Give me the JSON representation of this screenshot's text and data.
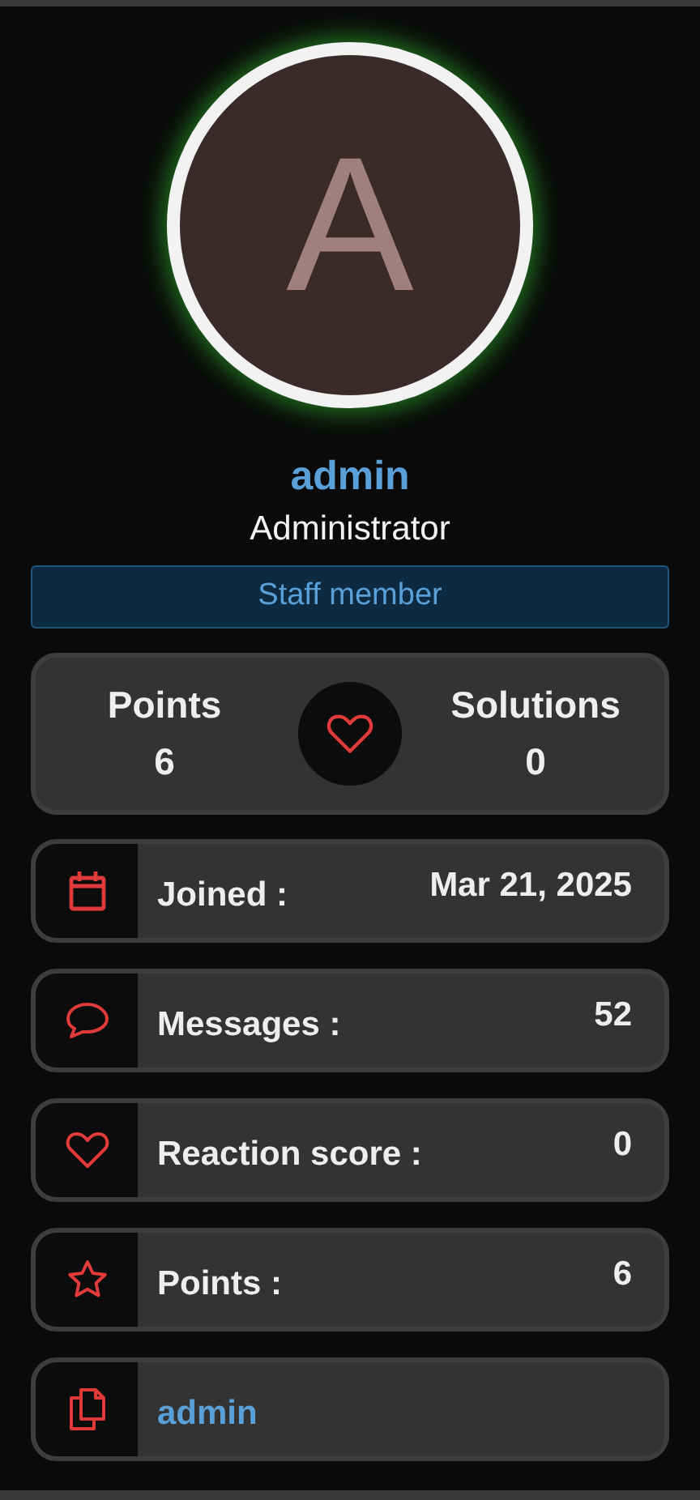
{
  "avatar": {
    "letter": "A"
  },
  "username": "admin",
  "role": "Administrator",
  "badge": "Staff member",
  "stats": [
    {
      "label": "Points",
      "value": "6"
    },
    {
      "label": "Solutions",
      "value": "0"
    }
  ],
  "rows": [
    {
      "label": "Joined :",
      "value": "Mar 21, 2025"
    },
    {
      "label": "Messages :",
      "value": "52"
    },
    {
      "label": "Reaction score :",
      "value": "0"
    },
    {
      "label": "Points :",
      "value": "6"
    },
    {
      "link": "admin"
    }
  ]
}
